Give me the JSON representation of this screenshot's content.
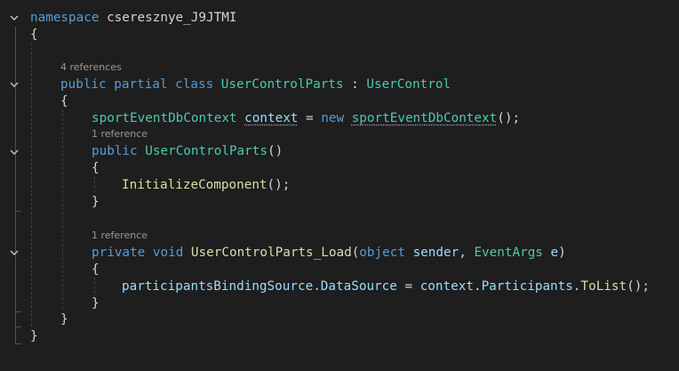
{
  "colors": {
    "background": "#1e1e1e",
    "keyword": "#569cd6",
    "type": "#4ec9b0",
    "method": "#dcdcaa",
    "variable": "#9cdcfe",
    "plain": "#d4d4d4",
    "codelens": "#999999",
    "fold_chevron": "#c5c5c5"
  },
  "code": {
    "namespace_kw": "namespace",
    "namespace_name": "cseresznye_J9JTMI",
    "ns_open": "{",
    "class_refs": "4 references",
    "class_kw_public": "public",
    "class_kw_partial": "partial",
    "class_kw_class": "class",
    "class_name": "UserControlParts",
    "class_colon": " : ",
    "base_class": "UserControl",
    "class_open": "{",
    "field_type": "sportEventDbContext",
    "field_name": "context",
    "field_assign": " = ",
    "field_new": "new",
    "field_ctor": "sportEventDbContext",
    "field_end": "();",
    "ctor_refs": "1 reference",
    "ctor_kw": "public",
    "ctor_name": "UserControlParts",
    "ctor_parens": "()",
    "ctor_open": "{",
    "ctor_call": "InitializeComponent",
    "ctor_call_end": "();",
    "ctor_close": "}",
    "load_refs": "1 reference",
    "load_kw_private": "private",
    "load_kw_void": "void",
    "load_name": "UserControlParts_Load",
    "load_paren_open": "(",
    "load_p1_type": "object",
    "load_p1_name": "sender",
    "load_comma": ", ",
    "load_p2_type": "EventArgs",
    "load_p2_name": "e",
    "load_paren_close": ")",
    "load_open": "{",
    "stmt_target": "participantsBindingSource",
    "stmt_dot1": ".",
    "stmt_prop": "DataSource",
    "stmt_assign": " = ",
    "stmt_ctx": "context",
    "stmt_dot2": ".",
    "stmt_participants": "Participants",
    "stmt_dot3": ".",
    "stmt_method": "ToList",
    "stmt_end": "();",
    "load_close": "}",
    "class_close": "}",
    "ns_close": "}"
  }
}
